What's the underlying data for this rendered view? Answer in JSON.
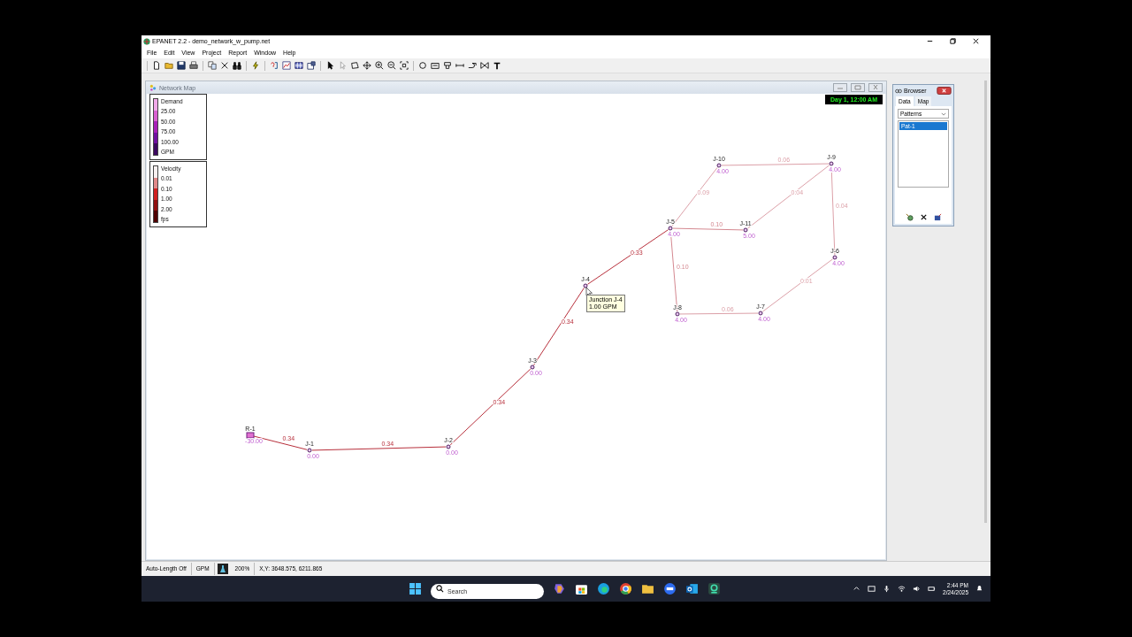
{
  "app_window": {
    "title": "EPANET 2.2 - demo_network_w_pump.net"
  },
  "menu": [
    "File",
    "Edit",
    "View",
    "Project",
    "Report",
    "Window",
    "Help"
  ],
  "network_map": {
    "title": "Network Map",
    "time": "Day 1, 12:00 AM",
    "legends": [
      {
        "title": "Demand",
        "labels": [
          "25.00",
          "50.00",
          "75.00",
          "100.00"
        ],
        "unit": "GPM",
        "segments": [
          {
            "color": "#f0a8e8"
          },
          {
            "color": "#d860d0"
          },
          {
            "color": "#a820b8"
          },
          {
            "color": "#7010a0"
          },
          {
            "color": "#3c0860"
          }
        ]
      },
      {
        "title": "Velocity",
        "labels": [
          "0.01",
          "0.10",
          "1.00",
          "2.00"
        ],
        "unit": "fps",
        "segments": [
          {
            "color": "#f8f0f0"
          },
          {
            "color": "#e08888"
          },
          {
            "color": "#d02020"
          },
          {
            "color": "#901010"
          },
          {
            "color": "#500000"
          }
        ]
      }
    ],
    "nodes": [
      {
        "kind": "reservoir",
        "label": "R-1",
        "value": "-30.00"
      },
      {
        "kind": "junction",
        "label": "J-1",
        "value": "0.00"
      },
      {
        "kind": "junction",
        "label": "J-2",
        "value": "0.00"
      },
      {
        "kind": "junction",
        "label": "J-3",
        "value": "0.00"
      },
      {
        "kind": "junction",
        "label": "J-4"
      },
      {
        "kind": "junction",
        "label": "J-5",
        "value": "4.00"
      },
      {
        "kind": "junction",
        "label": "J-10",
        "value": "4.00"
      },
      {
        "kind": "junction",
        "label": "J-9",
        "value": "4.00"
      },
      {
        "kind": "junction",
        "label": "J-11",
        "value": "5.00"
      },
      {
        "kind": "junction",
        "label": "J-6",
        "value": "4.00"
      },
      {
        "kind": "junction",
        "label": "J-8",
        "value": "4.00"
      },
      {
        "kind": "junction",
        "label": "J-7",
        "value": "4.00"
      }
    ],
    "links": [
      {
        "label": "0.34",
        "color": "#b8303c"
      },
      {
        "label": "0.34",
        "color": "#b8303c"
      },
      {
        "label": "0.34",
        "color": "#b8303c"
      },
      {
        "label": "0.34",
        "color": "#b8303c"
      },
      {
        "label": "0.33",
        "color": "#b8303c"
      },
      {
        "label": "0.09",
        "color": "#dca0a8"
      },
      {
        "label": "0.06",
        "color": "#dca0a8"
      },
      {
        "label": "0.04",
        "color": "#dca0a8"
      },
      {
        "label": "0.10",
        "color": "#d48890"
      },
      {
        "label": "0.04",
        "color": "#dca0a8"
      },
      {
        "label": "0.10",
        "color": "#d48890"
      },
      {
        "label": "0.06",
        "color": "#dca0a8"
      },
      {
        "label": "0.01",
        "color": "#dca0a8"
      }
    ],
    "tooltip": {
      "lines": [
        "Junction J-4",
        "1.00 GPM"
      ]
    }
  },
  "browser": {
    "title": "Browser",
    "tabs": [
      {
        "label": "Data",
        "selected": true
      },
      {
        "label": "Map",
        "selected": false
      }
    ],
    "category": "Patterns",
    "items": [
      {
        "label": "Pat-1",
        "selected": true
      }
    ]
  },
  "status_bar": {
    "auto_length": "Auto-Length Off",
    "units": "GPM",
    "zoom": "200%",
    "coordinates": "X,Y: 3648.575, 6211.865"
  },
  "taskbar": {
    "search_placeholder": "Search",
    "time": "2:44 PM",
    "date": "2/24/2025"
  }
}
